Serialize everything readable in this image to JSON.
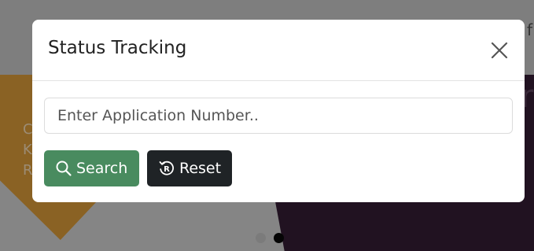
{
  "modal": {
    "title": "Status Tracking",
    "close_icon": "close-icon",
    "search": {
      "placeholder": "Enter Application Number..",
      "value": ""
    },
    "buttons": {
      "search_label": "Search",
      "search_icon": "search-icon",
      "reset_label": "Reset",
      "reset_icon": "reset-icon"
    }
  },
  "colors": {
    "search_button": "#498b5f",
    "reset_button": "#1f2326",
    "overlay": "#808080"
  },
  "carousel": {
    "active_index": 2,
    "count": 2
  }
}
